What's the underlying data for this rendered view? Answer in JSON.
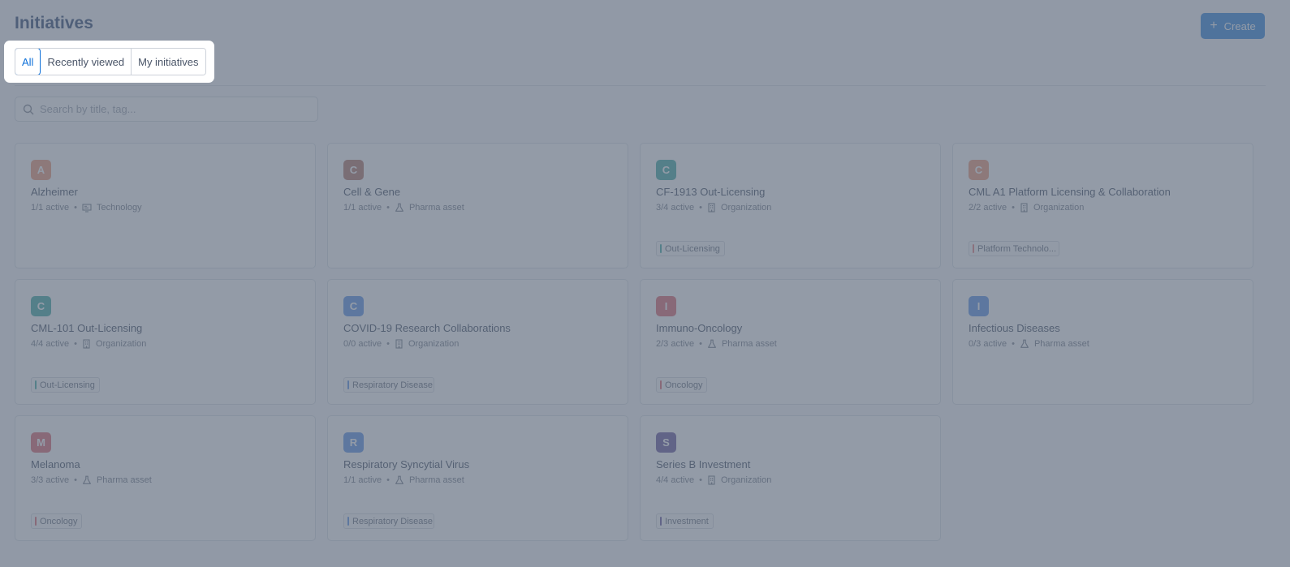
{
  "header": {
    "title": "Initiatives",
    "create_label": "Create"
  },
  "tabs": [
    {
      "label": "All",
      "active": true
    },
    {
      "label": "Recently viewed",
      "active": false
    },
    {
      "label": "My initiatives",
      "active": false
    }
  ],
  "search": {
    "placeholder": "Search by title, tag..."
  },
  "cards": [
    {
      "initial": "A",
      "color": "#e8855f",
      "title": "Alzheimer",
      "active": "1/1 active",
      "type": "Technology",
      "type_icon": "technology-icon",
      "tag": null,
      "tag_color": null
    },
    {
      "initial": "C",
      "color": "#a65d4e",
      "title": "Cell & Gene",
      "active": "1/1 active",
      "type": "Pharma asset",
      "type_icon": "flask-icon",
      "tag": null,
      "tag_color": null
    },
    {
      "initial": "C",
      "color": "#1e9c94",
      "title": "CF-1913 Out-Licensing",
      "active": "3/4 active",
      "type": "Organization",
      "type_icon": "building-icon",
      "tag": "Out-Licensing",
      "tag_color": "#1e9c94"
    },
    {
      "initial": "C",
      "color": "#e8855f",
      "title": "CML A1 Platform Licensing & Collaboration",
      "active": "2/2 active",
      "type": "Organization",
      "type_icon": "building-icon",
      "tag": "Platform Technolo...",
      "tag_color": "#e06a6a"
    },
    {
      "initial": "C",
      "color": "#1e9c94",
      "title": "CML-101 Out-Licensing",
      "active": "4/4 active",
      "type": "Organization",
      "type_icon": "building-icon",
      "tag": "Out-Licensing",
      "tag_color": "#1e9c94"
    },
    {
      "initial": "C",
      "color": "#3f7fe0",
      "title": "COVID-19 Research Collaborations",
      "active": "0/0 active",
      "type": "Organization",
      "type_icon": "building-icon",
      "tag": "Respiratory Disease",
      "tag_color": "#3f7fe0"
    },
    {
      "initial": "I",
      "color": "#d84b58",
      "title": "Immuno-Oncology",
      "active": "2/3 active",
      "type": "Pharma asset",
      "type_icon": "flask-icon",
      "tag": "Oncology",
      "tag_color": "#d84b58"
    },
    {
      "initial": "I",
      "color": "#3f7fe0",
      "title": "Infectious Diseases",
      "active": "0/3 active",
      "type": "Pharma asset",
      "type_icon": "flask-icon",
      "tag": null,
      "tag_color": null
    },
    {
      "initial": "M",
      "color": "#d84b58",
      "title": "Melanoma",
      "active": "3/3 active",
      "type": "Pharma asset",
      "type_icon": "flask-icon",
      "tag": "Oncology",
      "tag_color": "#d84b58"
    },
    {
      "initial": "R",
      "color": "#3f7fe0",
      "title": "Respiratory Syncytial Virus",
      "active": "1/1 active",
      "type": "Pharma asset",
      "type_icon": "flask-icon",
      "tag": "Respiratory Disease",
      "tag_color": "#3f7fe0"
    },
    {
      "initial": "S",
      "color": "#4b3a8c",
      "title": "Series B Investment",
      "active": "4/4 active",
      "type": "Organization",
      "type_icon": "building-icon",
      "tag": "Investment",
      "tag_color": "#4b3a8c"
    }
  ],
  "meta_separator": "•",
  "colors": {
    "accent": "#0c6fd8",
    "overlay": "#6a7485"
  }
}
